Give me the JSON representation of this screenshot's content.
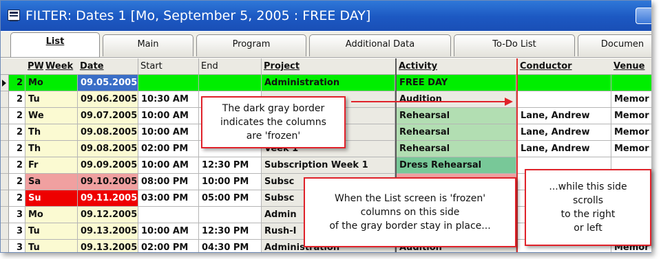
{
  "window": {
    "title": "FILTER: Dates  1 [Mo, September  5, 2005 :  FREE DAY]"
  },
  "tabs": [
    {
      "label": "List"
    },
    {
      "label": "Main"
    },
    {
      "label": "Program"
    },
    {
      "label": "Additional Data"
    },
    {
      "label": "To-Do List"
    },
    {
      "label": "Documen"
    }
  ],
  "columns": [
    "PW",
    "Week",
    "Date",
    "Start",
    "End",
    "Project",
    "Activity",
    "Conductor",
    "Venue"
  ],
  "rows": [
    {
      "pw": "2",
      "week": "Mo",
      "date": "09.05.2005",
      "start": "",
      "end": "",
      "project": "Administration",
      "activity": "FREE DAY",
      "conductor": "",
      "venue": ""
    },
    {
      "pw": "2",
      "week": "Tu",
      "date": "09.06.2005",
      "start": "10:30 AM",
      "end": "",
      "project": "",
      "activity": "Audition",
      "conductor": "",
      "venue": "Memor"
    },
    {
      "pw": "2",
      "week": "We",
      "date": "09.07.2005",
      "start": "10:00 AM",
      "end": "",
      "project": "Veek 1",
      "activity": "Rehearsal",
      "conductor": "Lane, Andrew",
      "venue": "Memor"
    },
    {
      "pw": "2",
      "week": "Th",
      "date": "09.08.2005",
      "start": "10:00 AM",
      "end": "",
      "project": "Veek 1",
      "activity": "Rehearsal",
      "conductor": "Lane, Andrew",
      "venue": "Memor"
    },
    {
      "pw": "2",
      "week": "Th",
      "date": "09.08.2005",
      "start": "02:00 PM",
      "end": "",
      "project": "Veek 1",
      "activity": "Rehearsal",
      "conductor": "Lane, Andrew",
      "venue": "Memor"
    },
    {
      "pw": "2",
      "week": "Fr",
      "date": "09.09.2005",
      "start": "10:00 AM",
      "end": "12:30 PM",
      "project": "Subscription Week 1",
      "activity": "Dress Rehearsal",
      "conductor": "",
      "venue": ""
    },
    {
      "pw": "2",
      "week": "Sa",
      "date": "09.10.2005",
      "start": "08:00 PM",
      "end": "10:00 PM",
      "project": "Subsc",
      "activity": "",
      "conductor": "",
      "venue": ""
    },
    {
      "pw": "2",
      "week": "Su",
      "date": "09.11.2005",
      "start": "03:00 PM",
      "end": "05:00 PM",
      "project": "Subsc",
      "activity": "",
      "conductor": "",
      "venue": ""
    },
    {
      "pw": "3",
      "week": "Mo",
      "date": "09.12.2005",
      "start": "",
      "end": "",
      "project": "Admin",
      "activity": "",
      "conductor": "",
      "venue": ""
    },
    {
      "pw": "3",
      "week": "Tu",
      "date": "09.13.2005",
      "start": "10:00 AM",
      "end": "12:30 PM",
      "project": "Rush-I",
      "activity": "",
      "conductor": "",
      "venue": ""
    },
    {
      "pw": "3",
      "week": "Tu",
      "date": "09.13.2005",
      "start": "02:00 PM",
      "end": "04:30 PM",
      "project": "Administration",
      "activity": "Audition",
      "conductor": "",
      "venue": "Memor"
    }
  ],
  "callouts": {
    "frozen_border": [
      "The dark gray border",
      "indicates the columns",
      "are 'frozen'"
    ],
    "frozen_side": [
      "When the List screen is 'frozen'",
      "columns on this side",
      "of the gray border stay in place..."
    ],
    "scroll_side": [
      "...while this side",
      "scrolls",
      "to the right",
      "or left"
    ]
  },
  "colors": {
    "title_bar": "#1c58c2",
    "free_day_row": "#00ee00",
    "date_selected": "#3a6ec7",
    "date_cell": "#fbfad2",
    "weekday_cell": "#fbfad2",
    "saturday": "#f0a0a0",
    "sunday": "#ee0000",
    "project_cell": "#ebeae3",
    "activity_rehearsal": "#b2deb2",
    "activity_dress": "#78c898",
    "callout_border": "#e0222a",
    "frozen_border": "#5a5a5a"
  }
}
